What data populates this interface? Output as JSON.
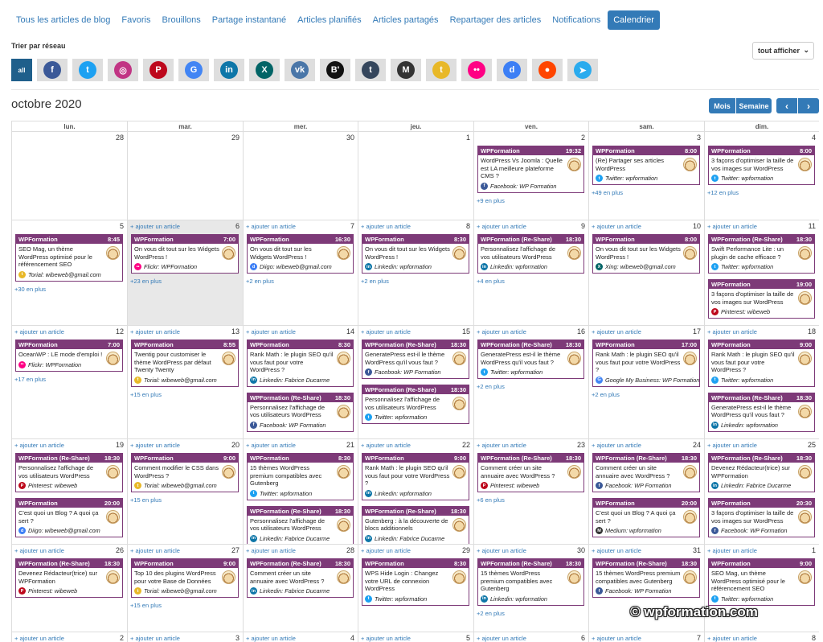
{
  "tabs": [
    {
      "label": "Tous les articles de blog",
      "active": false
    },
    {
      "label": "Favoris",
      "active": false
    },
    {
      "label": "Brouillons",
      "active": false
    },
    {
      "label": "Partage instantané",
      "active": false
    },
    {
      "label": "Articles planifiés",
      "active": false
    },
    {
      "label": "Articles partagés",
      "active": false
    },
    {
      "label": "Repartager des articles",
      "active": false
    },
    {
      "label": "Notifications",
      "active": false
    },
    {
      "label": "Calendrier",
      "active": true
    }
  ],
  "filter": {
    "label": "Trier par réseau",
    "all_label": "all",
    "select_label": "tout afficher",
    "networks": [
      {
        "id": "facebook",
        "icon": "facebook-icon",
        "color": "#3b5998"
      },
      {
        "id": "twitter",
        "icon": "twitter-icon",
        "color": "#1da1f2"
      },
      {
        "id": "instagram",
        "icon": "instagram-icon",
        "color": "#c13584"
      },
      {
        "id": "pinterest",
        "icon": "pinterest-icon",
        "color": "#bd081c"
      },
      {
        "id": "gmb",
        "icon": "google-my-business-icon",
        "color": "#4285f4"
      },
      {
        "id": "linkedin",
        "icon": "linkedin-icon",
        "color": "#0e76a8"
      },
      {
        "id": "xing",
        "icon": "xing-icon",
        "color": "#026466"
      },
      {
        "id": "vk",
        "icon": "vk-icon",
        "color": "#4a76a8"
      },
      {
        "id": "blogger",
        "icon": "blogger-icon",
        "color": "#111111"
      },
      {
        "id": "tumblr",
        "icon": "tumblr-icon",
        "color": "#35465c"
      },
      {
        "id": "medium",
        "icon": "medium-icon",
        "color": "#333333"
      },
      {
        "id": "torial",
        "icon": "torial-icon",
        "color": "#e8b828"
      },
      {
        "id": "flickr",
        "icon": "flickr-icon",
        "color": "#ff0084"
      },
      {
        "id": "diigo",
        "icon": "diigo-icon",
        "color": "#3d7ff5"
      },
      {
        "id": "reddit",
        "icon": "reddit-icon",
        "color": "#ff4500"
      },
      {
        "id": "telegram",
        "icon": "telegram-icon",
        "color": "#2aabee"
      }
    ]
  },
  "calendar": {
    "title": "octobre 2020",
    "view_month": "Mois",
    "view_week": "Semaine",
    "prev_icon": "chevron-left-icon",
    "next_icon": "chevron-right-icon",
    "add_label": "+ ajouter un article",
    "weekdays": [
      "lun.",
      "mar.",
      "mer.",
      "jeu.",
      "ven.",
      "sam.",
      "dim."
    ],
    "accent_color": "#7d3a78",
    "weeks": [
      [
        {
          "date": "28",
          "add": false,
          "events": []
        },
        {
          "date": "29",
          "add": false,
          "events": []
        },
        {
          "date": "30",
          "add": false,
          "events": []
        },
        {
          "date": "1",
          "add": false,
          "events": []
        },
        {
          "date": "2",
          "add": false,
          "more": "+9 en plus",
          "events": [
            {
              "account": "WPFormation",
              "time": "19:32",
              "text": "WordPress Vs Joomla : Quelle est LA meilleure plateforme CMS ?",
              "network": "facebook",
              "handle": "Facebook: WP Formation"
            }
          ]
        },
        {
          "date": "3",
          "add": false,
          "more": "+49 en plus",
          "events": [
            {
              "account": "WPFormation",
              "time": "8:00",
              "text": "(Re) Partager ses articles WordPress",
              "network": "twitter",
              "handle": "Twitter: wpformation"
            }
          ]
        },
        {
          "date": "4",
          "add": false,
          "more": "+12 en plus",
          "events": [
            {
              "account": "WPFormation",
              "time": "8:00",
              "text": "3 façons d'optimiser la taille de vos images sur WordPress",
              "network": "twitter",
              "handle": "Twitter: wpformation"
            }
          ]
        }
      ],
      [
        {
          "date": "5",
          "add": false,
          "more": "+30 en plus",
          "events": [
            {
              "account": "WPFormation",
              "time": "8:45",
              "text": "SEO Mag, un thème WordPress optimisé pour le référencement SEO",
              "network": "torial",
              "handle": "Torial: wibeweb@gmail.com"
            }
          ]
        },
        {
          "date": "6",
          "add": true,
          "today": true,
          "more": "+23 en plus",
          "events": [
            {
              "account": "WPFormation",
              "time": "7:00",
              "text": "On vous dit tout sur les Widgets WordPress !",
              "network": "flickr",
              "handle": "Flickr: WPFormation"
            }
          ]
        },
        {
          "date": "7",
          "add": true,
          "more": "+2 en plus",
          "events": [
            {
              "account": "WPFormation",
              "time": "16:30",
              "text": "On vous dit tout sur les Widgets WordPress !",
              "network": "diigo",
              "handle": "Diigo: wibeweb@gmail.com"
            }
          ]
        },
        {
          "date": "8",
          "add": true,
          "more": "+2 en plus",
          "events": [
            {
              "account": "WPFormation",
              "time": "8:30",
              "text": "On vous dit tout sur les Widgets WordPress !",
              "network": "linkedin",
              "handle": "Linkedin: wpformation"
            }
          ]
        },
        {
          "date": "9",
          "add": true,
          "more": "+4 en plus",
          "events": [
            {
              "account": "WPFormation (Re-Share)",
              "time": "18:30",
              "text": "Personnalisez l'affichage de vos utilisateurs WordPress",
              "network": "linkedin",
              "handle": "Linkedin: wpformation"
            }
          ]
        },
        {
          "date": "10",
          "add": true,
          "events": [
            {
              "account": "WPFormation",
              "time": "8:00",
              "text": "On vous dit tout sur les Widgets WordPress !",
              "network": "xing",
              "handle": "Xing: wibeweb@gmail.com"
            }
          ]
        },
        {
          "date": "11",
          "add": true,
          "events": [
            {
              "account": "WPFormation (Re-Share)",
              "time": "18:30",
              "text": "Swift Performance Lite : un plugin de cache efficace ?",
              "network": "twitter",
              "handle": "Twitter: wpformation"
            },
            {
              "account": "WPFormation",
              "time": "19:00",
              "text": "3 façons d'optimiser la taille de vos images sur WordPress",
              "network": "pinterest",
              "handle": "Pinterest: wibeweb"
            }
          ]
        }
      ],
      [
        {
          "date": "12",
          "add": true,
          "more": "+17 en plus",
          "events": [
            {
              "account": "WPFormation",
              "time": "7:00",
              "text": "OceanWP : LE mode d'emploi !",
              "network": "flickr",
              "handle": "Flickr: WPFormation"
            }
          ]
        },
        {
          "date": "13",
          "add": true,
          "more": "+15 en plus",
          "events": [
            {
              "account": "WPFormation",
              "time": "8:55",
              "text": "Twentig pour customiser le thème WordPress par défaut Twenty Twenty",
              "network": "torial",
              "handle": "Torial: wibeweb@gmail.com"
            }
          ]
        },
        {
          "date": "14",
          "add": true,
          "events": [
            {
              "account": "WPFormation",
              "time": "8:30",
              "text": "Rank Math : le plugin SEO qu'il vous faut pour votre WordPress ?",
              "network": "linkedin",
              "handle": "Linkedin: Fabrice Ducarme"
            },
            {
              "account": "WPFormation (Re-Share)",
              "time": "18:30",
              "text": "Personnalisez l'affichage de vos utilisateurs WordPress",
              "network": "facebook",
              "handle": "Facebook: WP Formation"
            }
          ]
        },
        {
          "date": "15",
          "add": true,
          "events": [
            {
              "account": "WPFormation (Re-Share)",
              "time": "18:30",
              "text": "GeneratePress est-il le thème WordPress qu'il vous faut ?",
              "network": "facebook",
              "handle": "Facebook: WP Formation"
            },
            {
              "account": "WPFormation (Re-Share)",
              "time": "18:30",
              "text": "Personnalisez l'affichage de vos utilisateurs WordPress",
              "network": "twitter",
              "handle": "Twitter: wpformation"
            }
          ]
        },
        {
          "date": "16",
          "add": true,
          "more": "+2 en plus",
          "events": [
            {
              "account": "WPFormation (Re-Share)",
              "time": "18:30",
              "text": "GeneratePress est-il le thème WordPress qu'il vous faut ?",
              "network": "twitter",
              "handle": "Twitter: wpformation"
            }
          ]
        },
        {
          "date": "17",
          "add": true,
          "more": "+2 en plus",
          "events": [
            {
              "account": "WPFormation",
              "time": "17:00",
              "text": "Rank Math : le plugin SEO qu'il vous faut pour votre WordPress ?",
              "network": "gmb",
              "handle": "Google My Business: WP Formation"
            }
          ]
        },
        {
          "date": "18",
          "add": true,
          "events": [
            {
              "account": "WPFormation",
              "time": "9:00",
              "text": "Rank Math : le plugin SEO qu'il vous faut pour votre WordPress ?",
              "network": "twitter",
              "handle": "Twitter: wpformation"
            },
            {
              "account": "WPFormation (Re-Share)",
              "time": "18:30",
              "text": "GeneratePress est-il le thème WordPress qu'il vous faut ?",
              "network": "linkedin",
              "handle": "Linkedin: wpformation"
            }
          ]
        }
      ],
      [
        {
          "date": "19",
          "add": true,
          "events": [
            {
              "account": "WPFormation (Re-Share)",
              "time": "18:30",
              "text": "Personnalisez l'affichage de vos utilisateurs WordPress",
              "network": "pinterest",
              "handle": "Pinterest: wibeweb"
            },
            {
              "account": "WPFormation",
              "time": "20:00",
              "text": "C'est quoi un Blog ? A quoi ça sert ?",
              "network": "diigo",
              "handle": "Diigo: wibeweb@gmail.com"
            }
          ]
        },
        {
          "date": "20",
          "add": true,
          "more": "+15 en plus",
          "events": [
            {
              "account": "WPFormation",
              "time": "9:00",
              "text": "Comment modifier le CSS dans WordPress ?",
              "network": "torial",
              "handle": "Torial: wibeweb@gmail.com"
            }
          ]
        },
        {
          "date": "21",
          "add": true,
          "events": [
            {
              "account": "WPFormation",
              "time": "8:30",
              "text": "15 thèmes WordPress premium compatibles avec Gutenberg",
              "network": "twitter",
              "handle": "Twitter: wpformation"
            },
            {
              "account": "WPFormation (Re-Share)",
              "time": "18:30",
              "text": "Personnalisez l'affichage de vos utilisateurs WordPress",
              "network": "linkedin",
              "handle": "Linkedin: Fabrice Ducarme"
            }
          ]
        },
        {
          "date": "22",
          "add": true,
          "events": [
            {
              "account": "WPFormation",
              "time": "9:00",
              "text": "Rank Math : le plugin SEO qu'il vous faut pour votre WordPress ?",
              "network": "linkedin",
              "handle": "Linkedin: wpformation"
            },
            {
              "account": "WPFormation (Re-Share)",
              "time": "18:30",
              "text": "Gutenberg : à la découverte de blocs additionnels",
              "network": "linkedin",
              "handle": "Linkedin: Fabrice Ducarme"
            }
          ]
        },
        {
          "date": "23",
          "add": true,
          "more": "+6 en plus",
          "events": [
            {
              "account": "WPFormation (Re-Share)",
              "time": "18:30",
              "text": "Comment créer un site annuaire avec WordPress ?",
              "network": "pinterest",
              "handle": "Pinterest: wibeweb"
            }
          ]
        },
        {
          "date": "24",
          "add": true,
          "events": [
            {
              "account": "WPFormation (Re-Share)",
              "time": "18:30",
              "text": "Comment créer un site annuaire avec WordPress ?",
              "network": "facebook",
              "handle": "Facebook: WP Formation"
            },
            {
              "account": "WPFormation",
              "time": "20:00",
              "text": "C'est quoi un Blog ? A quoi ça sert ?",
              "network": "medium",
              "handle": "Medium: wpformation"
            }
          ]
        },
        {
          "date": "25",
          "add": true,
          "events": [
            {
              "account": "WPFormation (Re-Share)",
              "time": "18:30",
              "text": "Devenez Rédacteur(trice) sur WPFormation",
              "network": "linkedin",
              "handle": "Linkedin: Fabrice Ducarme"
            },
            {
              "account": "WPFormation",
              "time": "20:30",
              "text": "3 façons d'optimiser la taille de vos images sur WordPress",
              "network": "facebook",
              "handle": "Facebook: WP Formation"
            }
          ]
        }
      ],
      [
        {
          "date": "26",
          "add": true,
          "events": [
            {
              "account": "WPFormation (Re-Share)",
              "time": "18:30",
              "text": "Devenez Rédacteur(trice) sur WPFormation",
              "network": "pinterest",
              "handle": "Pinterest: wibeweb"
            }
          ]
        },
        {
          "date": "27",
          "add": true,
          "more": "+15 en plus",
          "events": [
            {
              "account": "WPFormation",
              "time": "9:00",
              "text": "Top 10 des plugins WordPress pour votre Base de Données",
              "network": "torial",
              "handle": "Torial: wibeweb@gmail.com"
            }
          ]
        },
        {
          "date": "28",
          "add": true,
          "events": [
            {
              "account": "WPFormation (Re-Share)",
              "time": "18:30",
              "text": "Comment créer un site annuaire avec WordPress ?",
              "network": "linkedin",
              "handle": "Linkedin: Fabrice Ducarme"
            }
          ]
        },
        {
          "date": "29",
          "add": true,
          "events": [
            {
              "account": "WPFormation",
              "time": "8:30",
              "text": "WPS Hide Login : Changez votre URL de connexion WordPress",
              "network": "twitter",
              "handle": "Twitter: wpformation"
            }
          ]
        },
        {
          "date": "30",
          "add": true,
          "more": "+2 en plus",
          "events": [
            {
              "account": "WPFormation (Re-Share)",
              "time": "18:30",
              "text": "15 thèmes WordPress premium compatibles avec Gutenberg",
              "network": "linkedin",
              "handle": "Linkedin: wpformation"
            }
          ]
        },
        {
          "date": "31",
          "add": true,
          "events": [
            {
              "account": "WPFormation (Re-Share)",
              "time": "18:30",
              "text": "15 thèmes WordPress premium compatibles avec Gutenberg",
              "network": "facebook",
              "handle": "Facebook: WP Formation"
            }
          ]
        },
        {
          "date": "1",
          "add": true,
          "events": [
            {
              "account": "WPFormation",
              "time": "9:00",
              "text": "SEO Mag, un thème WordPress optimisé pour le référencement SEO",
              "network": "twitter",
              "handle": "Twitter: wpformation"
            }
          ]
        }
      ],
      [
        {
          "date": "2",
          "add": true,
          "events": []
        },
        {
          "date": "3",
          "add": true,
          "events": []
        },
        {
          "date": "4",
          "add": true,
          "events": []
        },
        {
          "date": "5",
          "add": true,
          "events": []
        },
        {
          "date": "6",
          "add": true,
          "events": []
        },
        {
          "date": "7",
          "add": true,
          "events": []
        },
        {
          "date": "8",
          "add": true,
          "events": []
        }
      ]
    ]
  },
  "watermark": {
    "text": "© wpformation.com"
  }
}
